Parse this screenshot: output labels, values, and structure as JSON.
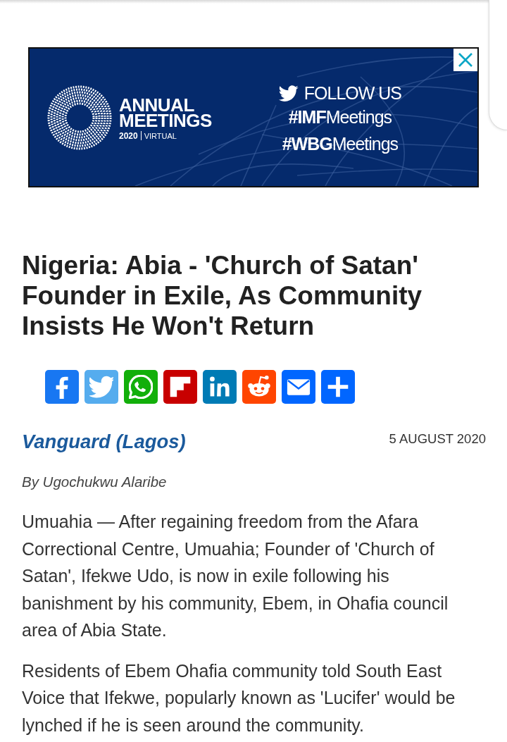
{
  "ad": {
    "logo_title": "ANNUAL MEETINGS",
    "year": "2020",
    "edition": "VIRTUAL",
    "follow": "FOLLOW US",
    "hashtags": [
      "**#IMF**Meetings",
      "**#WBG**Meetings"
    ]
  },
  "article": {
    "headline": "Nigeria: Abia - 'Church of Satan' Founder in Exile, As Community Insists He Won't Return",
    "share_buttons": [
      {
        "kind": "facebook",
        "color": "#1877f2"
      },
      {
        "kind": "twitter",
        "color": "#55acee"
      },
      {
        "kind": "whatsapp",
        "color": "#12af0a"
      },
      {
        "kind": "flipboard",
        "color": "#c80000"
      },
      {
        "kind": "linkedin",
        "color": "#007bb5"
      },
      {
        "kind": "reddit",
        "color": "#ff4500"
      },
      {
        "kind": "email",
        "color": "#0166ff"
      },
      {
        "kind": "share",
        "color": "#0166ff"
      }
    ],
    "source": "Vanguard (Lagos)",
    "date": "5 AUGUST 2020",
    "byline": "By Ugochukwu Alaribe",
    "paragraphs": [
      "Umuahia — After regaining freedom from the Afara Correctional Centre, Umuahia; Founder of 'Church of Satan', Ifekwe Udo, is now in exile following his banishment by his community, Ebem, in Ohafia council area of Abia State.",
      "Residents of Ebem Ohafia community told South East Voice that Ifekwe, popularly known as 'Lucifer' would be lynched if he is seen around the community."
    ]
  }
}
